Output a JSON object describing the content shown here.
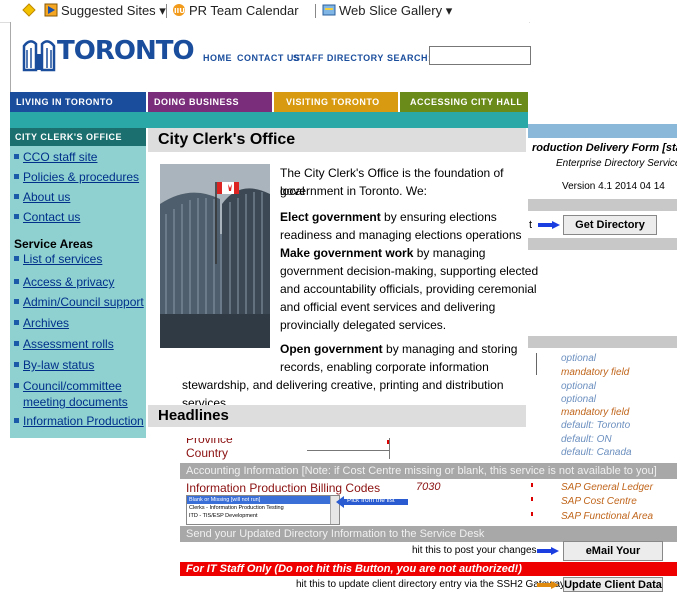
{
  "favorites": {
    "suggested": "Suggested Sites",
    "pr_calendar": "PR Team Calendar",
    "web_slice": "Web Slice Gallery"
  },
  "header": {
    "logo_text": "TORONTO",
    "links": [
      "HOME",
      "CONTACT US",
      "STAFF DIRECTORY"
    ],
    "search_label": "SEARCH:",
    "search_value": ""
  },
  "nav": {
    "items": [
      {
        "label": "LIVING IN TORONTO",
        "color": "#1a4d9c"
      },
      {
        "label": "DOING BUSINESS",
        "color": "#7a2d7a"
      },
      {
        "label": "VISITING TORONTO",
        "color": "#d89a10"
      },
      {
        "label": "ACCESSING CITY HALL",
        "color": "#6a8a1a"
      }
    ]
  },
  "sidebar": {
    "heading": "CITY CLERK'S OFFICE",
    "links_top": [
      "CCO staff site",
      "Policies & procedures",
      "About us",
      "Contact us"
    ],
    "service_areas_label": "Service Areas",
    "links_service": [
      "List of services",
      "Access & privacy",
      "Admin/Council support",
      "Archives",
      "Assessment rolls",
      "By-law status",
      "Council/committee",
      "meeting documents",
      "Information Production"
    ]
  },
  "main": {
    "title": "City Clerk's Office",
    "intro_1": "The City Clerk's Office is the foundation of local",
    "intro_2": "government in Toronto. We:",
    "elect_bold": "Elect government",
    "elect_1": " by ensuring elections",
    "elect_2": "readiness and managing elections operations",
    "make_bold": "Make government work",
    "make_1": " by managing",
    "make_2": "government decision-making, supporting elected",
    "make_3": "and accountability officials, providing ceremonial",
    "make_4": "and official event services and delivering",
    "make_5": "provincially delegated services.",
    "open_bold": "Open government",
    "open_1": " by managing and storing",
    "open_2": "records, enabling corporate information",
    "open_3": "stewardship, and delivering creative, printing and distribution",
    "open_4": "services.",
    "headlines": "Headlines"
  },
  "form": {
    "title": "roduction Delivery Form [staff]",
    "subtitle": "Enterprise Directory Services",
    "version": "Version 4.1 2014 04 14",
    "get_directory_button": "Get Directory Info",
    "hints": [
      {
        "text": "optional",
        "kind": "opt"
      },
      {
        "text": "mandatory field",
        "kind": "mand"
      },
      {
        "text": "optional",
        "kind": "opt"
      },
      {
        "text": "optional",
        "kind": "opt"
      },
      {
        "text": "mandatory field",
        "kind": "mand"
      },
      {
        "text": "default: Toronto",
        "kind": "defv"
      },
      {
        "text": "default: ON",
        "kind": "defv"
      },
      {
        "text": "default: Canada",
        "kind": "defv"
      }
    ],
    "province_label": "Province",
    "country_label": "Country",
    "accounting_bar": "Accounting Information [Note: if Cost Centre missing or blank, this service is not available to you]",
    "billing_label": "Information Production Billing Codes",
    "billing_options": [
      "Blank or Missing [will not run]",
      "Clerks - Information Production Testing",
      "ITD - TIS/ESP Development"
    ],
    "pick_label": "Pick from the list",
    "billing_code": "7030",
    "sap": [
      "SAP General Ledger",
      "SAP Cost Centre",
      "SAP Functional Area"
    ],
    "send_bar": "Send your Updated Directory Information to the Service Desk",
    "post_hint": "hit this to post your changes",
    "email_button": "eMail Your Changes",
    "it_only": "For IT Staff Only (Do not hit this Button, you are not authorized!)",
    "update_hint": "hit this to update client directory entry via the SSH2 Gateway",
    "update_button": "Update Client Data"
  },
  "colors": {
    "toronto_blue": "#1a4d9c",
    "teal": "#2aa7a7",
    "sidebar_bg": "#8fd1d1",
    "arrow_blue": "#1a3ee0",
    "arrow_orange": "#e08a10",
    "it_red": "#ee0000"
  }
}
